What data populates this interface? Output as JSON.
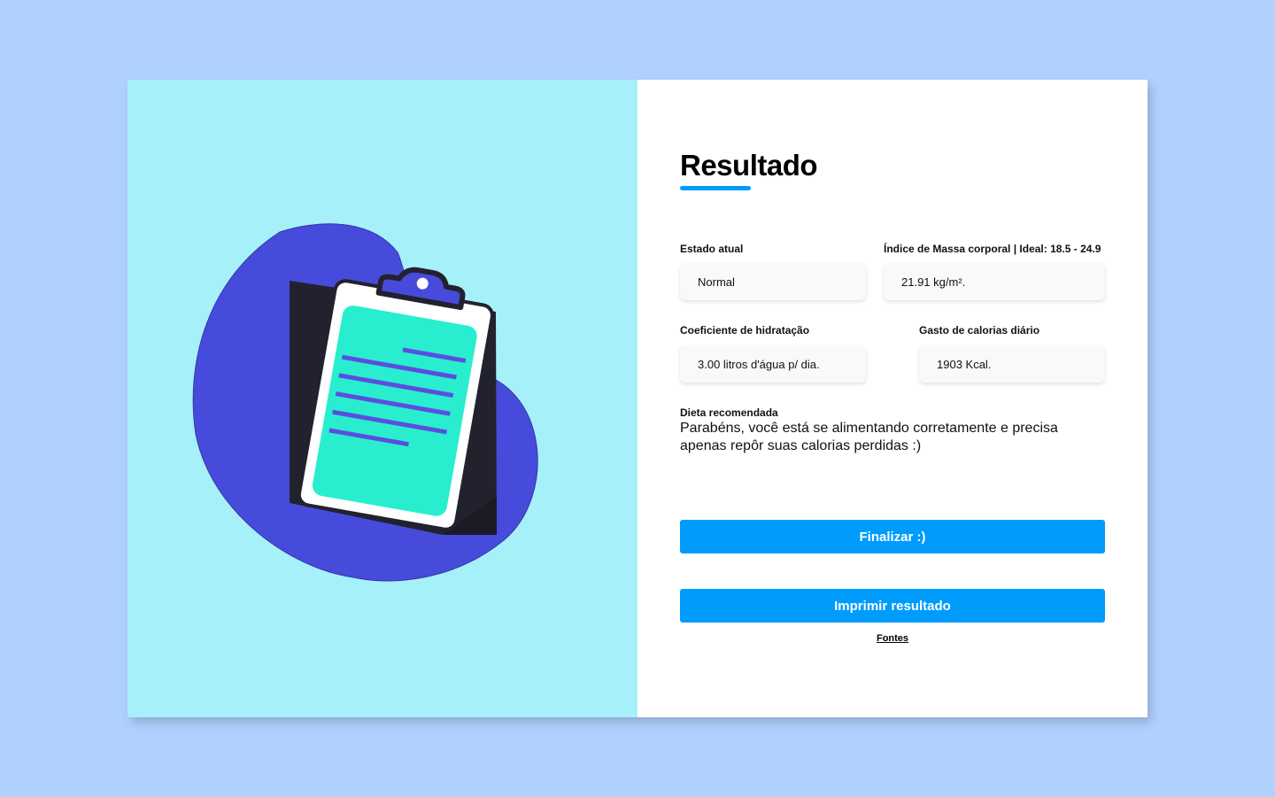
{
  "result": {
    "title": "Resultado",
    "fields": {
      "estado_label": "Estado atual",
      "estado_value": "Normal",
      "imc_label": "Índice de Massa corporal | Ideal: 18.5 - 24.9",
      "imc_value": "21.91 kg/m².",
      "hidratacao_label": "Coeficiente de hidratação",
      "hidratacao_value": "3.00 litros d'água p/ dia.",
      "calorias_label": "Gasto de calorias diário",
      "calorias_value": "1903 Kcal."
    },
    "diet_label": "Dieta recomendada",
    "diet_text": "Parabéns, você está se alimentando corretamente e precisa apenas repôr suas calorias perdidas :)",
    "finalize_button": "Finalizar :)",
    "print_button": "Imprimir resultado",
    "sources_link": "Fontes"
  },
  "illustration": {
    "icon": "clipboard-icon"
  },
  "colors": {
    "page_background": "#b0d1fd",
    "left_panel": "#a6f0fa",
    "blob": "#474bdb",
    "accent_button": "#009cfc",
    "clipboard_board": "#22222e",
    "clipboard_paper": "#28eecf"
  }
}
